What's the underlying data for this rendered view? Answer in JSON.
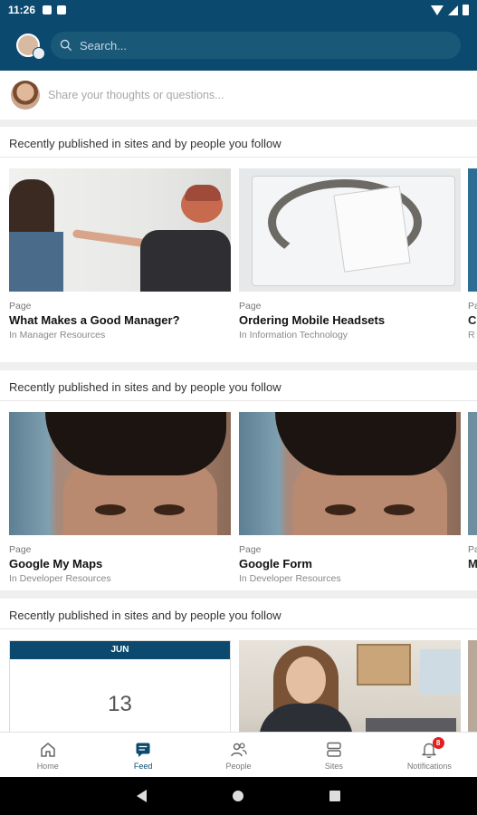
{
  "status_bar": {
    "time": "11:26"
  },
  "search": {
    "placeholder": "Search..."
  },
  "composer": {
    "placeholder": "Share your thoughts or questions..."
  },
  "sections": [
    {
      "title": "Recently published in sites and by people you follow",
      "cards": [
        {
          "type": "Page",
          "title": "What Makes a Good Manager?",
          "location": "In Manager Resources"
        },
        {
          "type": "Page",
          "title": "Ordering Mobile Headsets",
          "location": "In Information Technology"
        }
      ],
      "peek": {
        "type": "Pa",
        "title": "C",
        "location": "R"
      }
    },
    {
      "title": "Recently published in sites and by people you follow",
      "cards": [
        {
          "type": "Page",
          "title": "Google My Maps",
          "location": "In Developer Resources"
        },
        {
          "type": "Page",
          "title": "Google Form",
          "location": "In Developer Resources"
        }
      ],
      "peek": {
        "type": "Pa",
        "title": "M",
        "location": ""
      }
    },
    {
      "title": "Recently published in sites and by people you follow",
      "calendar": {
        "month": "JUN",
        "day": "13"
      }
    }
  ],
  "bottom_nav": {
    "items": [
      {
        "label": "Home",
        "icon": "home-icon"
      },
      {
        "label": "Feed",
        "icon": "feed-icon",
        "active": true
      },
      {
        "label": "People",
        "icon": "people-icon"
      },
      {
        "label": "Sites",
        "icon": "sites-icon"
      },
      {
        "label": "Notifications",
        "icon": "bell-icon",
        "badge": "8"
      }
    ]
  },
  "colors": {
    "primary": "#0b4a6e",
    "badge": "#e02020"
  }
}
